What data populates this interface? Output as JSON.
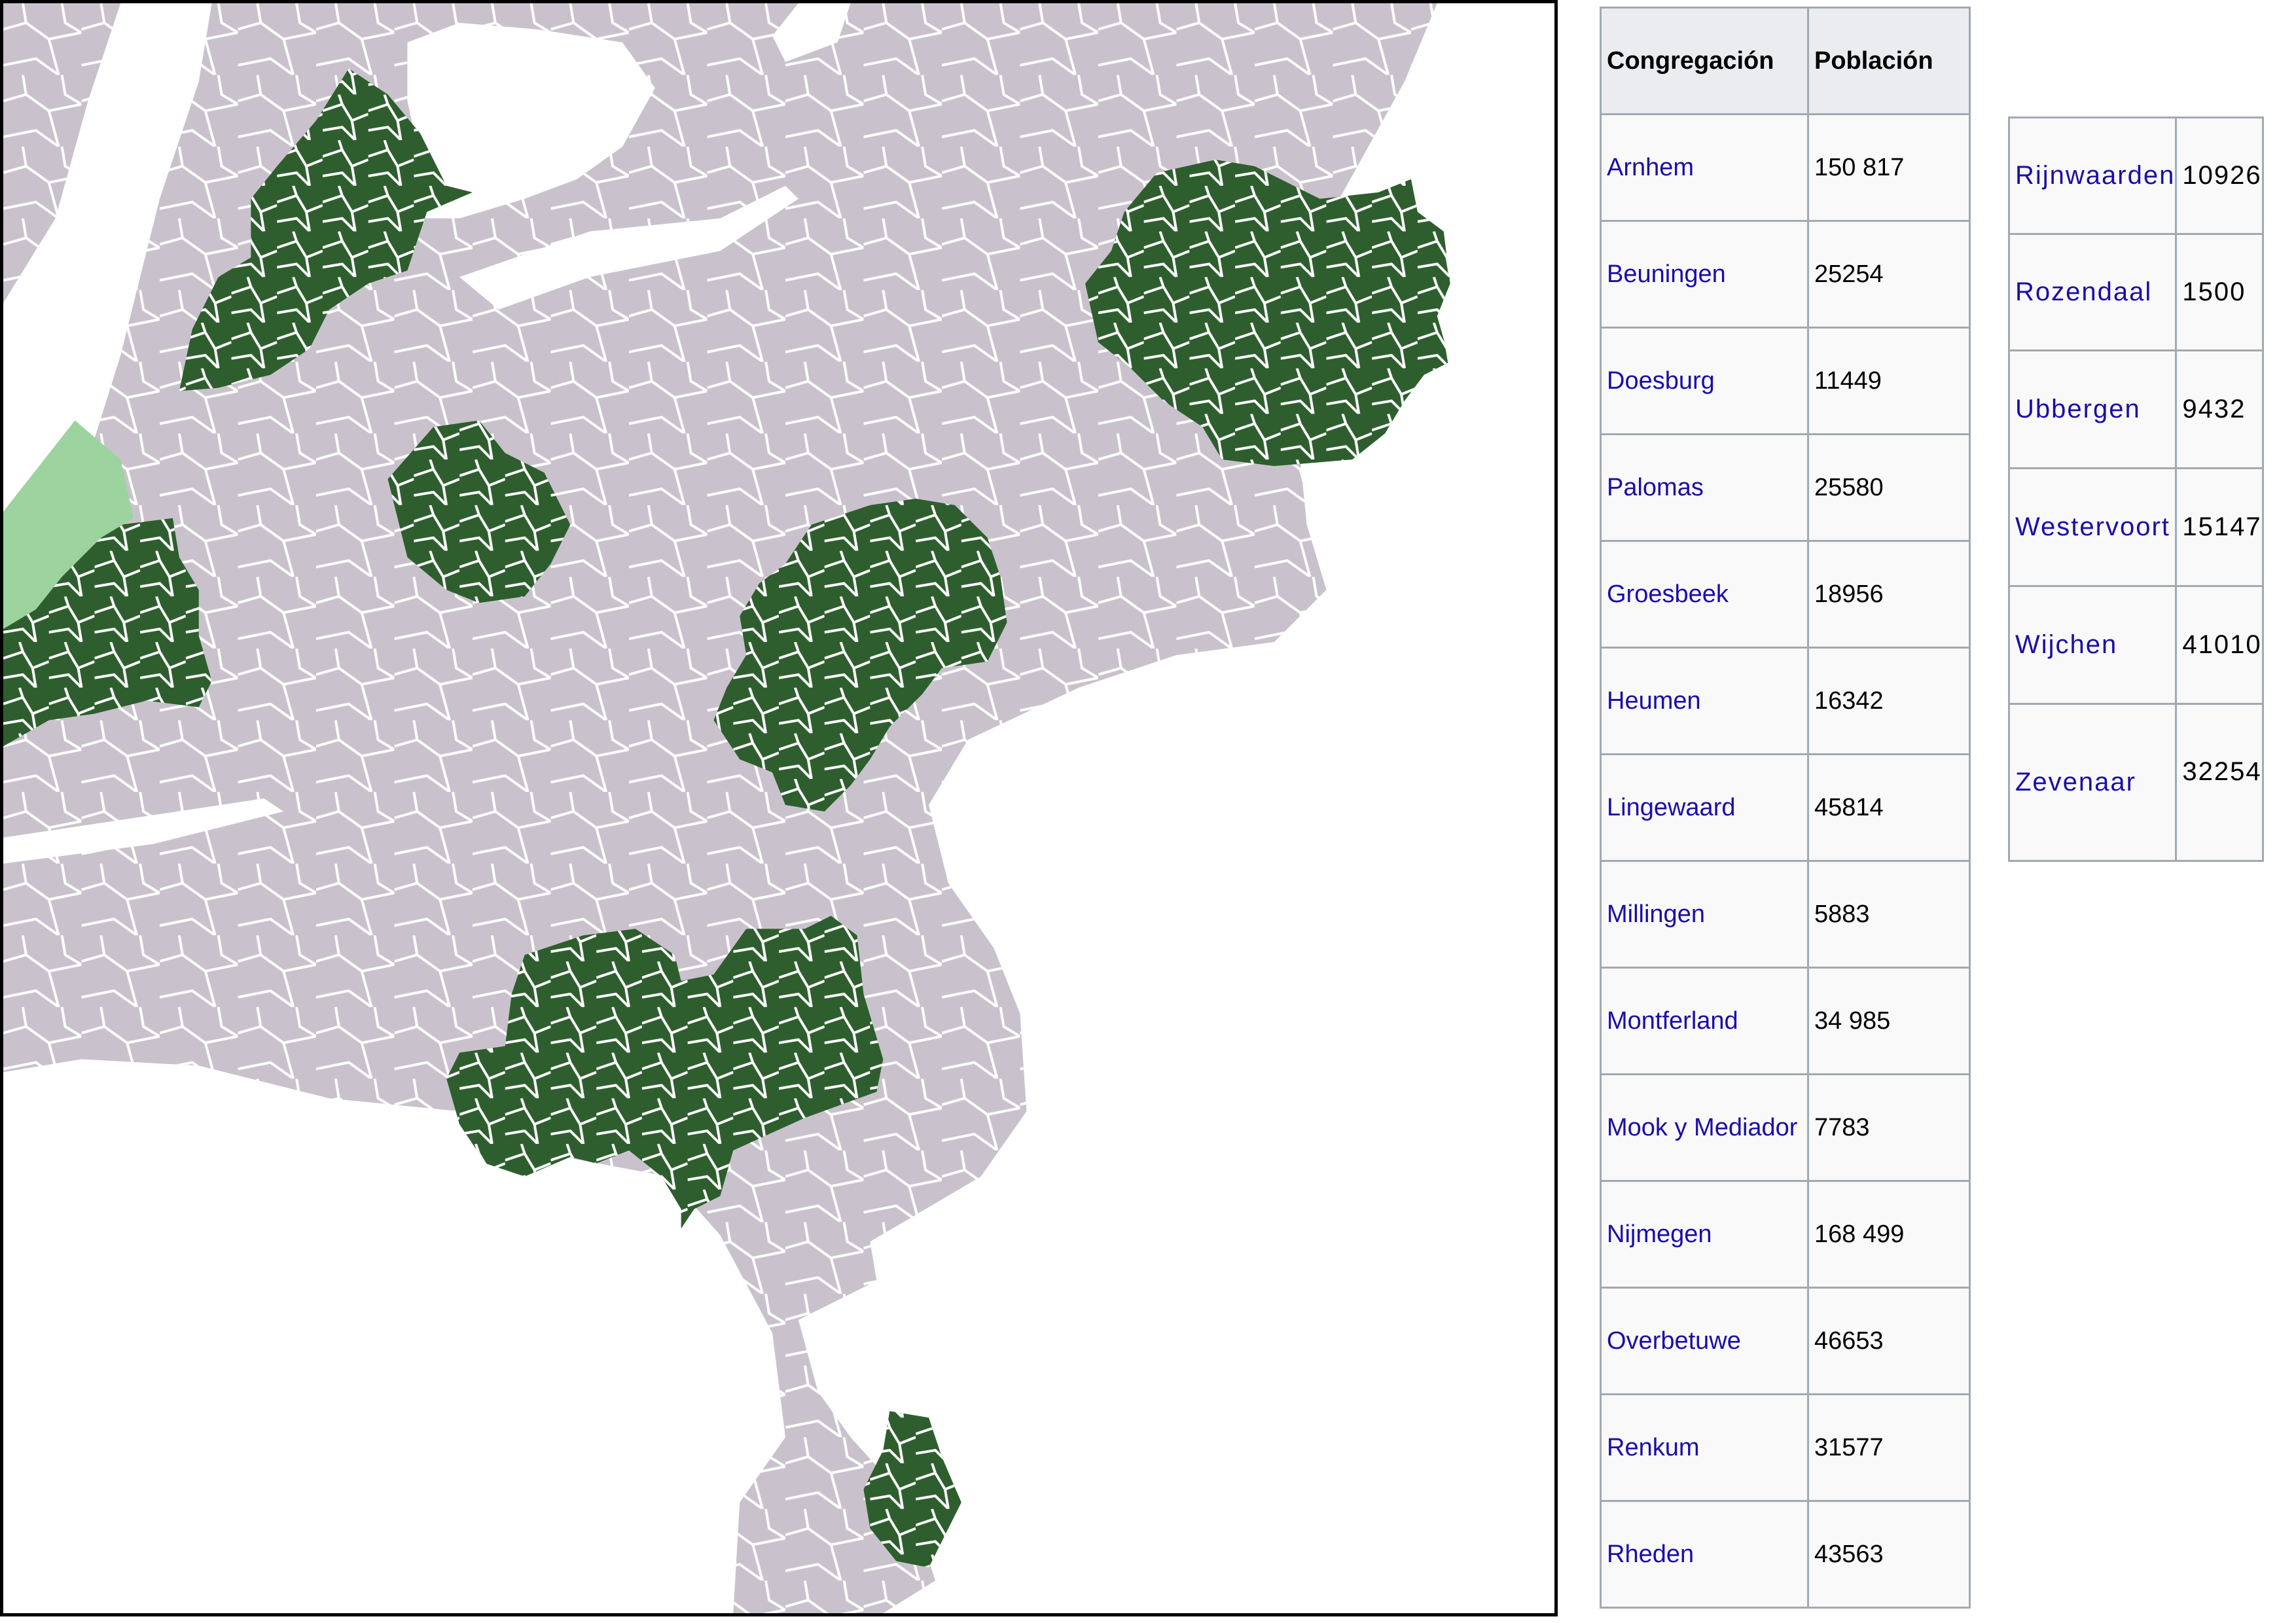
{
  "colors": {
    "land": "#c9c2cc",
    "border": "#ffffff",
    "highlight": "#2e5e2e",
    "highlight_light": "#9dd39e",
    "water": "#ffffff",
    "frame": "#000000",
    "link": "#1a0dab",
    "table_header_bg": "#eaecf0",
    "table_bg": "#f9f9f9",
    "table_border": "#a2a9b1"
  },
  "table_main": {
    "headers": [
      "Congregación",
      "Población"
    ],
    "rows": [
      {
        "name": "Arnhem",
        "population": "150 817"
      },
      {
        "name": "Beuningen",
        "population": "25254"
      },
      {
        "name": "Doesburg",
        "population": "11449"
      },
      {
        "name": "Palomas",
        "population": "25580"
      },
      {
        "name": "Groesbeek",
        "population": "18956"
      },
      {
        "name": "Heumen",
        "population": "16342"
      },
      {
        "name": "Lingewaard",
        "population": "45814"
      },
      {
        "name": "Millingen",
        "population": "5883"
      },
      {
        "name": "Montferland",
        "population": "34 985"
      },
      {
        "name": "Mook y Mediador",
        "population": "7783"
      },
      {
        "name": "Nijmegen",
        "population": "168 499"
      },
      {
        "name": "Overbetuwe",
        "population": "46653"
      },
      {
        "name": "Renkum",
        "population": "31577"
      },
      {
        "name": "Rheden",
        "population": "43563"
      }
    ]
  },
  "table_side": {
    "rows": [
      {
        "name": "Rijnwaarden",
        "population": "10926"
      },
      {
        "name": "Rozendaal",
        "population": "1500"
      },
      {
        "name": "Ubbergen",
        "population": "9432"
      },
      {
        "name": "Westervoort",
        "population": "15147"
      },
      {
        "name": "Wijchen",
        "population": "41010"
      },
      {
        "name": "Zevenaar",
        "population": "32254"
      }
    ]
  }
}
